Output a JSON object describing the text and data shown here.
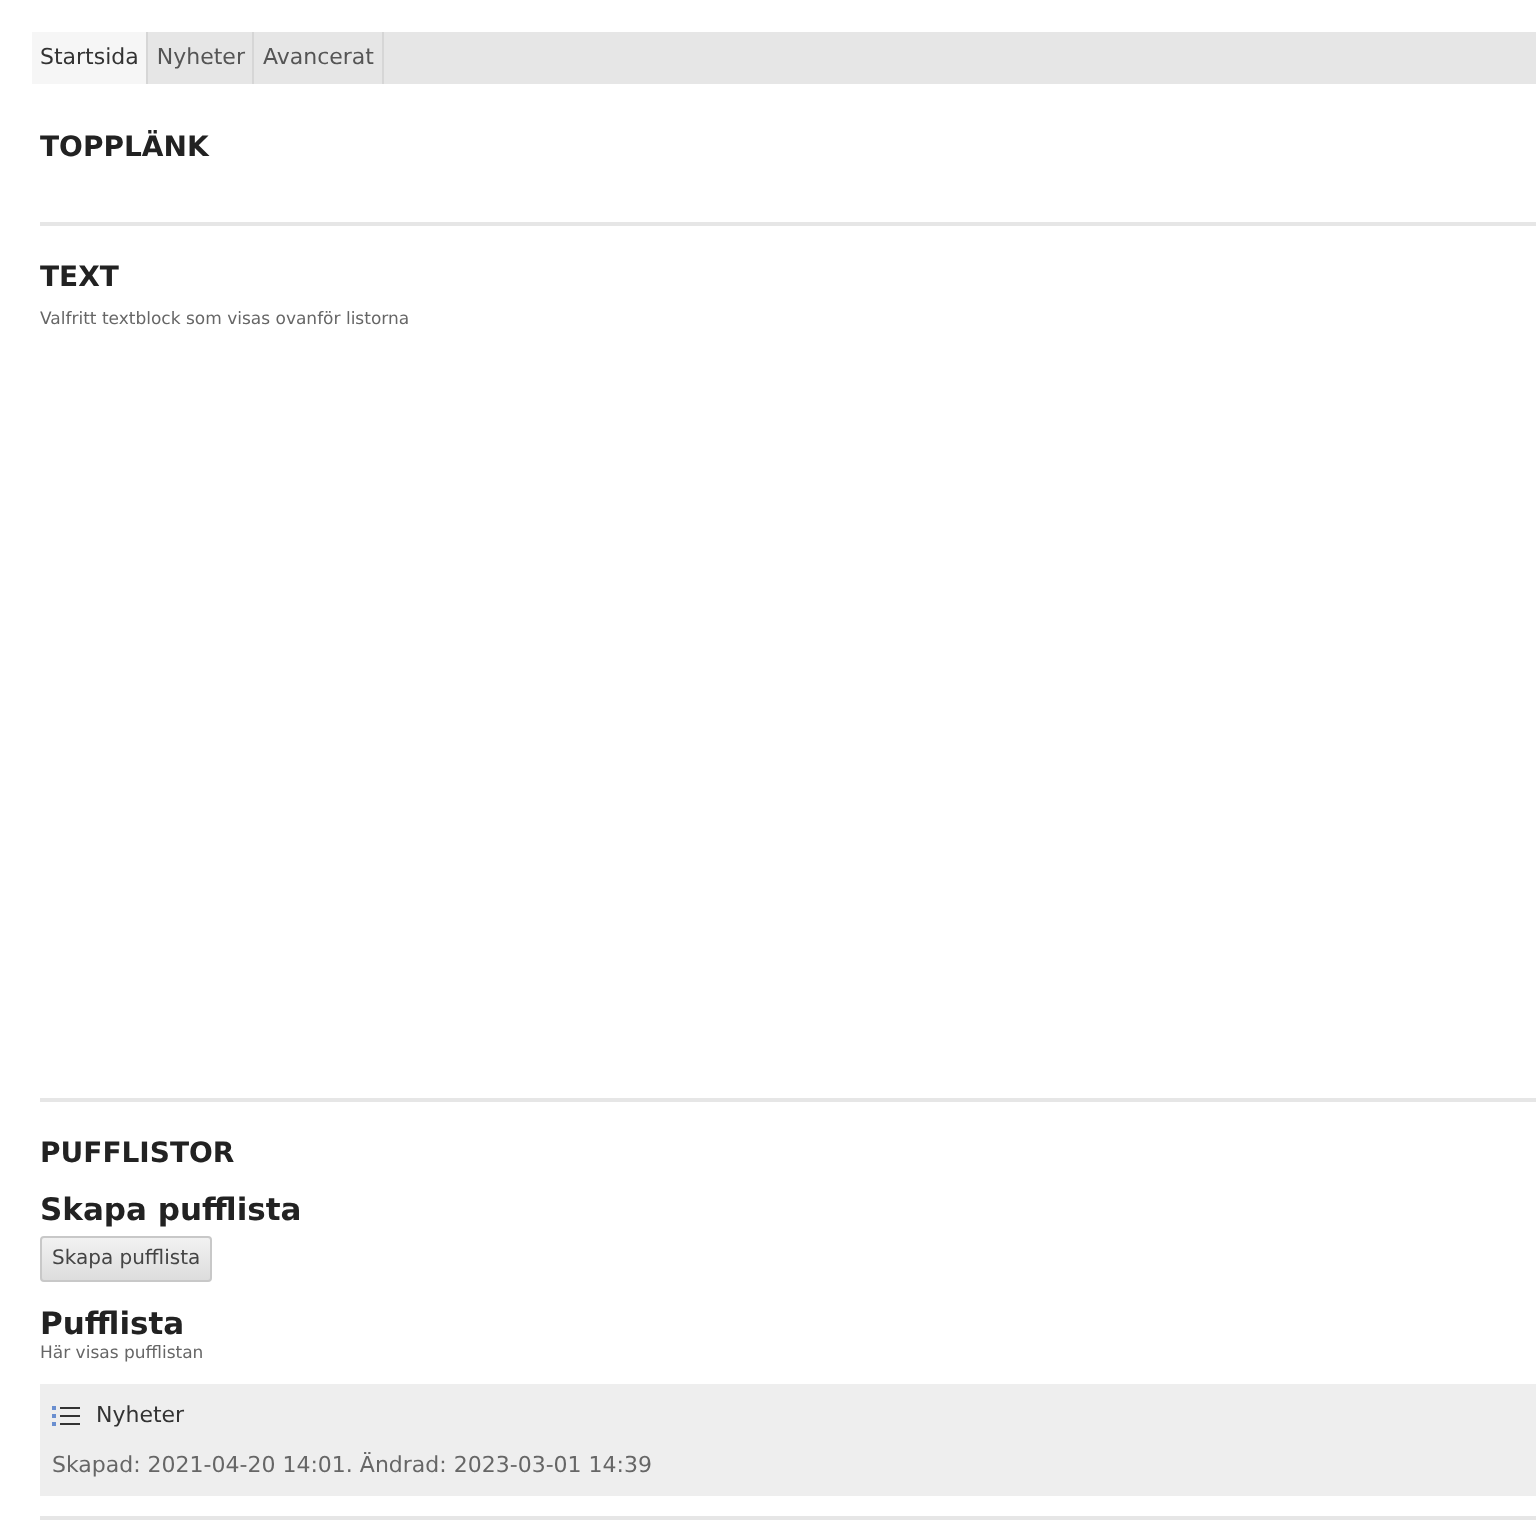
{
  "tabs": [
    {
      "label": "Startsida",
      "selected": true
    },
    {
      "label": "Nyheter",
      "selected": false
    },
    {
      "label": "Avancerat",
      "selected": false
    }
  ],
  "sections": [
    {
      "heading": "TOPPLÄNK"
    },
    {
      "heading": "TEXT",
      "description": "Valfritt textblock som visas ovanför listorna"
    }
  ],
  "pufflistor": {
    "heading": "PUFFLISTOR",
    "create_heading": "Skapa pufflista",
    "create_button": "Skapa pufflista",
    "list_heading": "Pufflista",
    "list_description": "Här visas pufflistan",
    "items": [
      {
        "title": "Nyheter",
        "meta": "Skapad: 2021-04-20 14:01. Ändrad: 2023-03-01 14:39"
      }
    ]
  }
}
